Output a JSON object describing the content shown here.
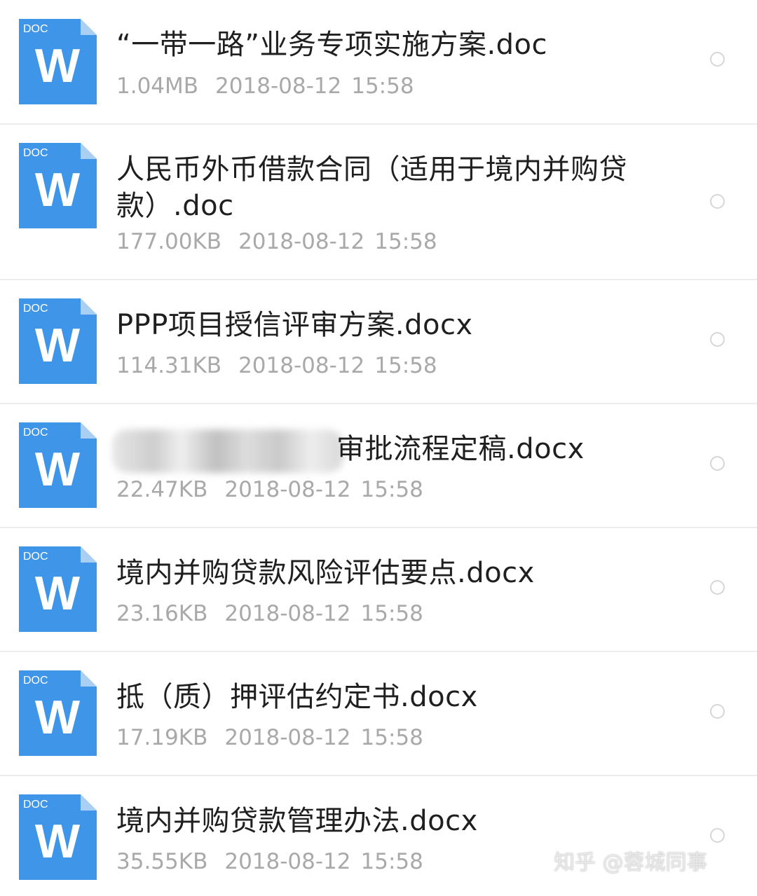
{
  "icon": {
    "badge": "DOC",
    "letter": "W",
    "color": "#3f95e8"
  },
  "files": [
    {
      "name": "“一带一路”业务专项实施方案.doc",
      "size": "1.04MB",
      "date": "2018-08-12",
      "time": "15:58"
    },
    {
      "name": "人民币外币借款合同（适用于境内并购贷款）.doc",
      "size": "177.00KB",
      "date": "2018-08-12",
      "time": "15:58"
    },
    {
      "name": "PPP项目授信评审方案.docx",
      "size": "114.31KB",
      "date": "2018-08-12",
      "time": "15:58"
    },
    {
      "name": "审批流程定稿.docx",
      "size": "22.47KB",
      "date": "2018-08-12",
      "time": "15:58"
    },
    {
      "name": "境内并购贷款风险评估要点.docx",
      "size": "23.16KB",
      "date": "2018-08-12",
      "time": "15:58"
    },
    {
      "name": "抵（质）押评估约定书.docx",
      "size": "17.19KB",
      "date": "2018-08-12",
      "time": "15:58"
    },
    {
      "name": "境内并购贷款管理办法.docx",
      "size": "35.55KB",
      "date": "2018-08-12",
      "time": "15:58"
    }
  ],
  "watermark": "知乎 @蓉城同事"
}
